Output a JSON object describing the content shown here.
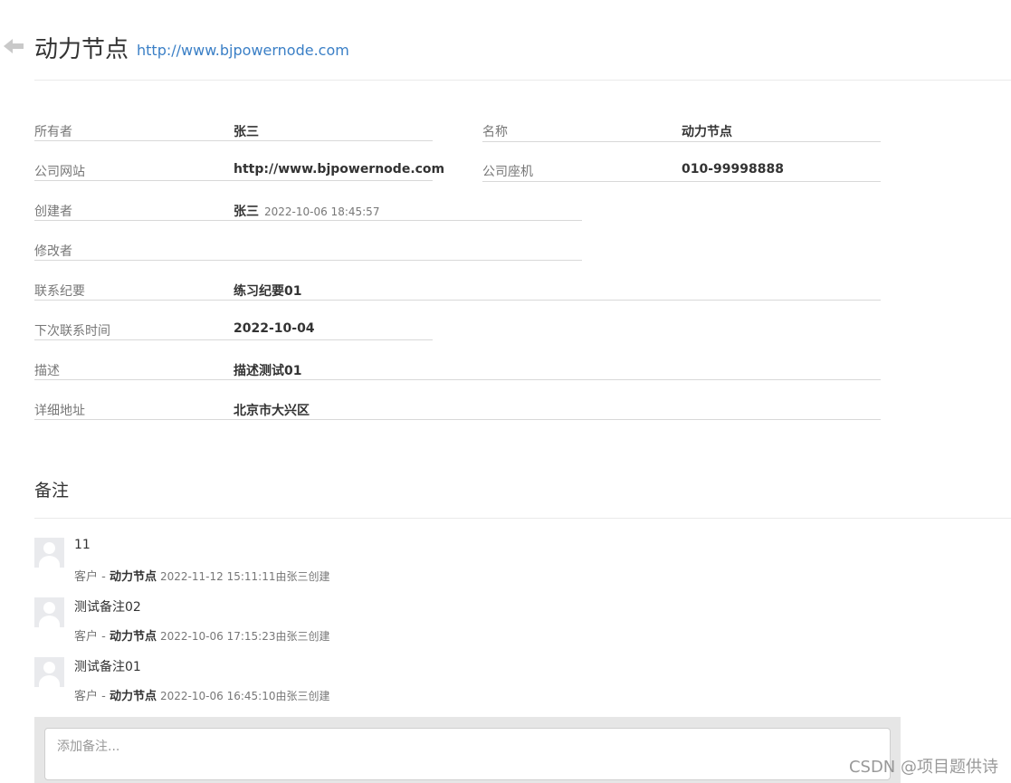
{
  "header": {
    "title": "动力节点",
    "website": "http://www.bjpowernode.com"
  },
  "details": {
    "owner_label": "所有者",
    "owner_value": "张三",
    "name_label": "名称",
    "name_value": "动力节点",
    "website_label": "公司网站",
    "website_value": "http://www.bjpowernode.com",
    "phone_label": "公司座机",
    "phone_value": "010-99998888",
    "creator_label": "创建者",
    "creator_value": "张三",
    "create_time": "2022-10-06 18:45:57",
    "editor_label": "修改者",
    "editor_value": "",
    "summary_label": "联系纪要",
    "summary_value": "练习纪要01",
    "next_contact_label": "下次联系时间",
    "next_contact_value": "2022-10-04",
    "description_label": "描述",
    "description_value": "描述测试01",
    "address_label": "详细地址",
    "address_value": "北京市大兴区"
  },
  "remarks": {
    "section_title": "备注",
    "items": [
      {
        "text": "11",
        "type": "客户",
        "separator": "-",
        "customer": "动力节点",
        "meta": "2022-11-12 15:11:11由张三创建"
      },
      {
        "text": "测试备注02",
        "type": "客户",
        "separator": "-",
        "customer": "动力节点",
        "meta": "2022-10-06 17:15:23由张三创建"
      },
      {
        "text": "测试备注01",
        "type": "客户",
        "separator": "-",
        "customer": "动力节点",
        "meta": "2022-10-06 16:45:10由张三创建"
      }
    ],
    "add_placeholder": "添加备注..."
  },
  "watermark": "CSDN @项目题供诗"
}
